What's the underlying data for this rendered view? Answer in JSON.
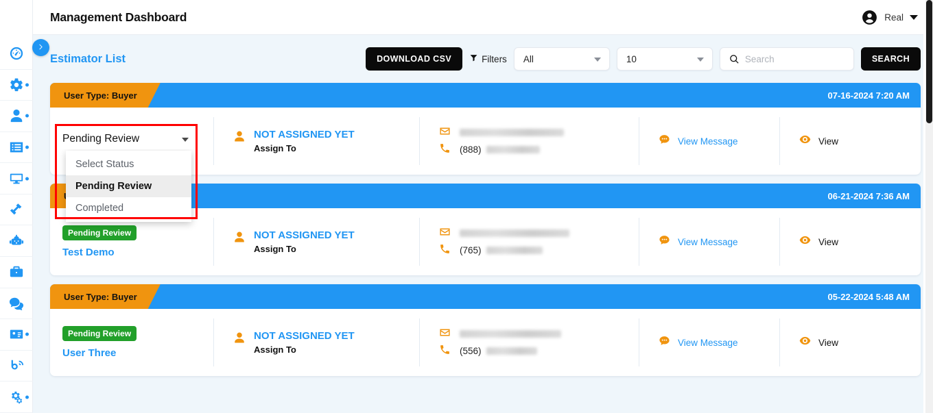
{
  "window": {
    "title": "Management Dashboard"
  },
  "account": {
    "name": "Real",
    "avatar_icon": "user-circle-icon",
    "caret_icon": "chevron-down-icon"
  },
  "sidebar": {
    "toggle_icon": "chevron-right-icon",
    "items": [
      {
        "icon": "speedometer-icon",
        "dot": false
      },
      {
        "icon": "gear-icon",
        "dot": true
      },
      {
        "icon": "user-icon",
        "dot": true
      },
      {
        "icon": "list-icon",
        "dot": true
      },
      {
        "icon": "monitor-icon",
        "dot": true
      },
      {
        "icon": "hammer-icon",
        "dot": false
      },
      {
        "icon": "robot-icon",
        "dot": false
      },
      {
        "icon": "briefcase-icon",
        "dot": false
      },
      {
        "icon": "chat-bubbles-icon",
        "dot": false
      },
      {
        "icon": "id-card-icon",
        "dot": true
      },
      {
        "icon": "blog-icon",
        "dot": false
      },
      {
        "icon": "gears-icon",
        "dot": true
      }
    ]
  },
  "toolbar": {
    "page_heading": "Estimator List",
    "download_csv_label": "DOWNLOAD CSV",
    "filters_label": "Filters",
    "filters_icon": "funnel-icon",
    "status_filter": {
      "value": "All",
      "options": [
        "All"
      ]
    },
    "page_size": {
      "value": "10",
      "options": [
        "10"
      ]
    },
    "search": {
      "value": "",
      "placeholder": "Search",
      "icon": "search-icon"
    },
    "search_button_label": "SEARCH"
  },
  "status_dropdown": {
    "selected": "Pending Review",
    "arrow_icon": "caret-down-icon",
    "options": [
      {
        "label": "Select Status",
        "selected": false
      },
      {
        "label": "Pending Review",
        "selected": true
      },
      {
        "label": "Completed",
        "selected": false
      }
    ]
  },
  "colors": {
    "accent_blue": "#2196f3",
    "ribbon_orange": "#f0940f",
    "badge_green": "#22a02a",
    "highlight_red": "#ff0000",
    "button_black": "#0a0a0a",
    "page_bg": "#eff6fb"
  },
  "cards": [
    {
      "user_type": "User Type: Buyer",
      "date": "07-16-2024 7:20 AM",
      "status_badge": "",
      "customer_name": "",
      "assigned_to": "NOT ASSIGNED YET",
      "assign_sub": "Assign To",
      "assign_icon": "user-icon",
      "email_icon": "envelope-icon",
      "email": "",
      "email_redacted": true,
      "phone_icon": "phone-icon",
      "phone_prefix": "(888)",
      "phone_redacted": true,
      "message_icon": "comment-icon",
      "message_label": "View Message",
      "view_icon": "eye-icon",
      "view_label": "View"
    },
    {
      "user_type": "User Type: Buyer",
      "date": "06-21-2024 7:36 AM",
      "status_badge": "Pending Review",
      "customer_name": "Test Demo",
      "assigned_to": "NOT ASSIGNED YET",
      "assign_sub": "Assign To",
      "assign_icon": "user-icon",
      "email_icon": "envelope-icon",
      "email": "",
      "email_redacted": true,
      "phone_icon": "phone-icon",
      "phone_prefix": "(765)",
      "phone_redacted": true,
      "message_icon": "comment-icon",
      "message_label": "View Message",
      "view_icon": "eye-icon",
      "view_label": "View"
    },
    {
      "user_type": "User Type: Buyer",
      "date": "05-22-2024 5:48 AM",
      "status_badge": "Pending Review",
      "customer_name": "User Three",
      "assigned_to": "NOT ASSIGNED YET",
      "assign_sub": "Assign To",
      "assign_icon": "user-icon",
      "email_icon": "envelope-icon",
      "email": "",
      "email_redacted": true,
      "phone_icon": "phone-icon",
      "phone_prefix": "(556)",
      "phone_redacted": true,
      "message_icon": "comment-icon",
      "message_label": "View Message",
      "view_icon": "eye-icon",
      "view_label": "View"
    }
  ]
}
